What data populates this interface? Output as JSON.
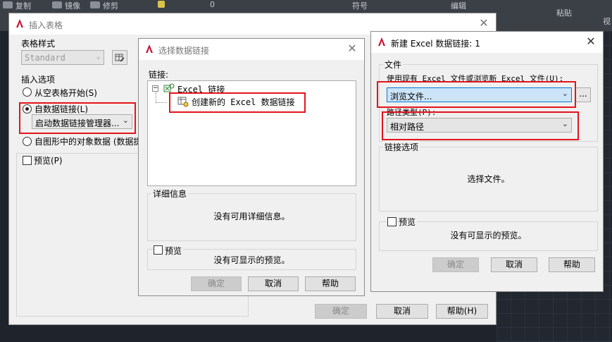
{
  "background_ribbon": {
    "labels": [
      "复制",
      "镜像",
      "修剪",
      "0",
      "编辑",
      "符号",
      "粘贴",
      "视"
    ]
  },
  "insert_table_dialog": {
    "title": "插入表格",
    "table_style_label": "表格样式",
    "table_style_value": "Standard",
    "insert_options_label": "插入选项",
    "option_empty": "从空表格开始(S)",
    "option_data_link": "自数据链接(L)",
    "data_link_manager": "启动数据链接管理器...",
    "option_object_data": "自图形中的对象数据 (数据提",
    "preview_label": "预览(P)",
    "ok_label": "确定",
    "cancel_label": "取消",
    "help_label": "帮助(H)"
  },
  "select_data_link_dialog": {
    "title": "选择数据链接",
    "links_label": "链接:",
    "tree_root": "Excel 链接",
    "tree_child": "创建新的 Excel 数据链接",
    "details_label": "详细信息",
    "details_text": "没有可用详细信息。",
    "preview_label": "预览",
    "preview_text": "没有可显示的预览。",
    "ok_label": "确定",
    "cancel_label": "取消",
    "help_label": "帮助"
  },
  "new_excel_link_dialog": {
    "title": "新建 Excel 数据链接: 1",
    "file_label": "文件",
    "file_prompt": "使用现有 Excel 文件或浏览新 Excel 文件(U):",
    "file_combo_value": "浏览文件...",
    "browse_button": "...",
    "path_type_label": "路径类型(P):",
    "path_type_value": "相对路径",
    "link_options_label": "链接选项",
    "link_options_text": "选择文件。",
    "preview_label": "预览",
    "preview_text": "没有可显示的预览。",
    "ok_label": "确定",
    "cancel_label": "取消",
    "help_label": "帮助"
  },
  "colors": {
    "highlight_box": "#e3141b",
    "selected_combo": "#cce4f7",
    "selected_border": "#0078d7",
    "acad_red": "#c8102e"
  }
}
